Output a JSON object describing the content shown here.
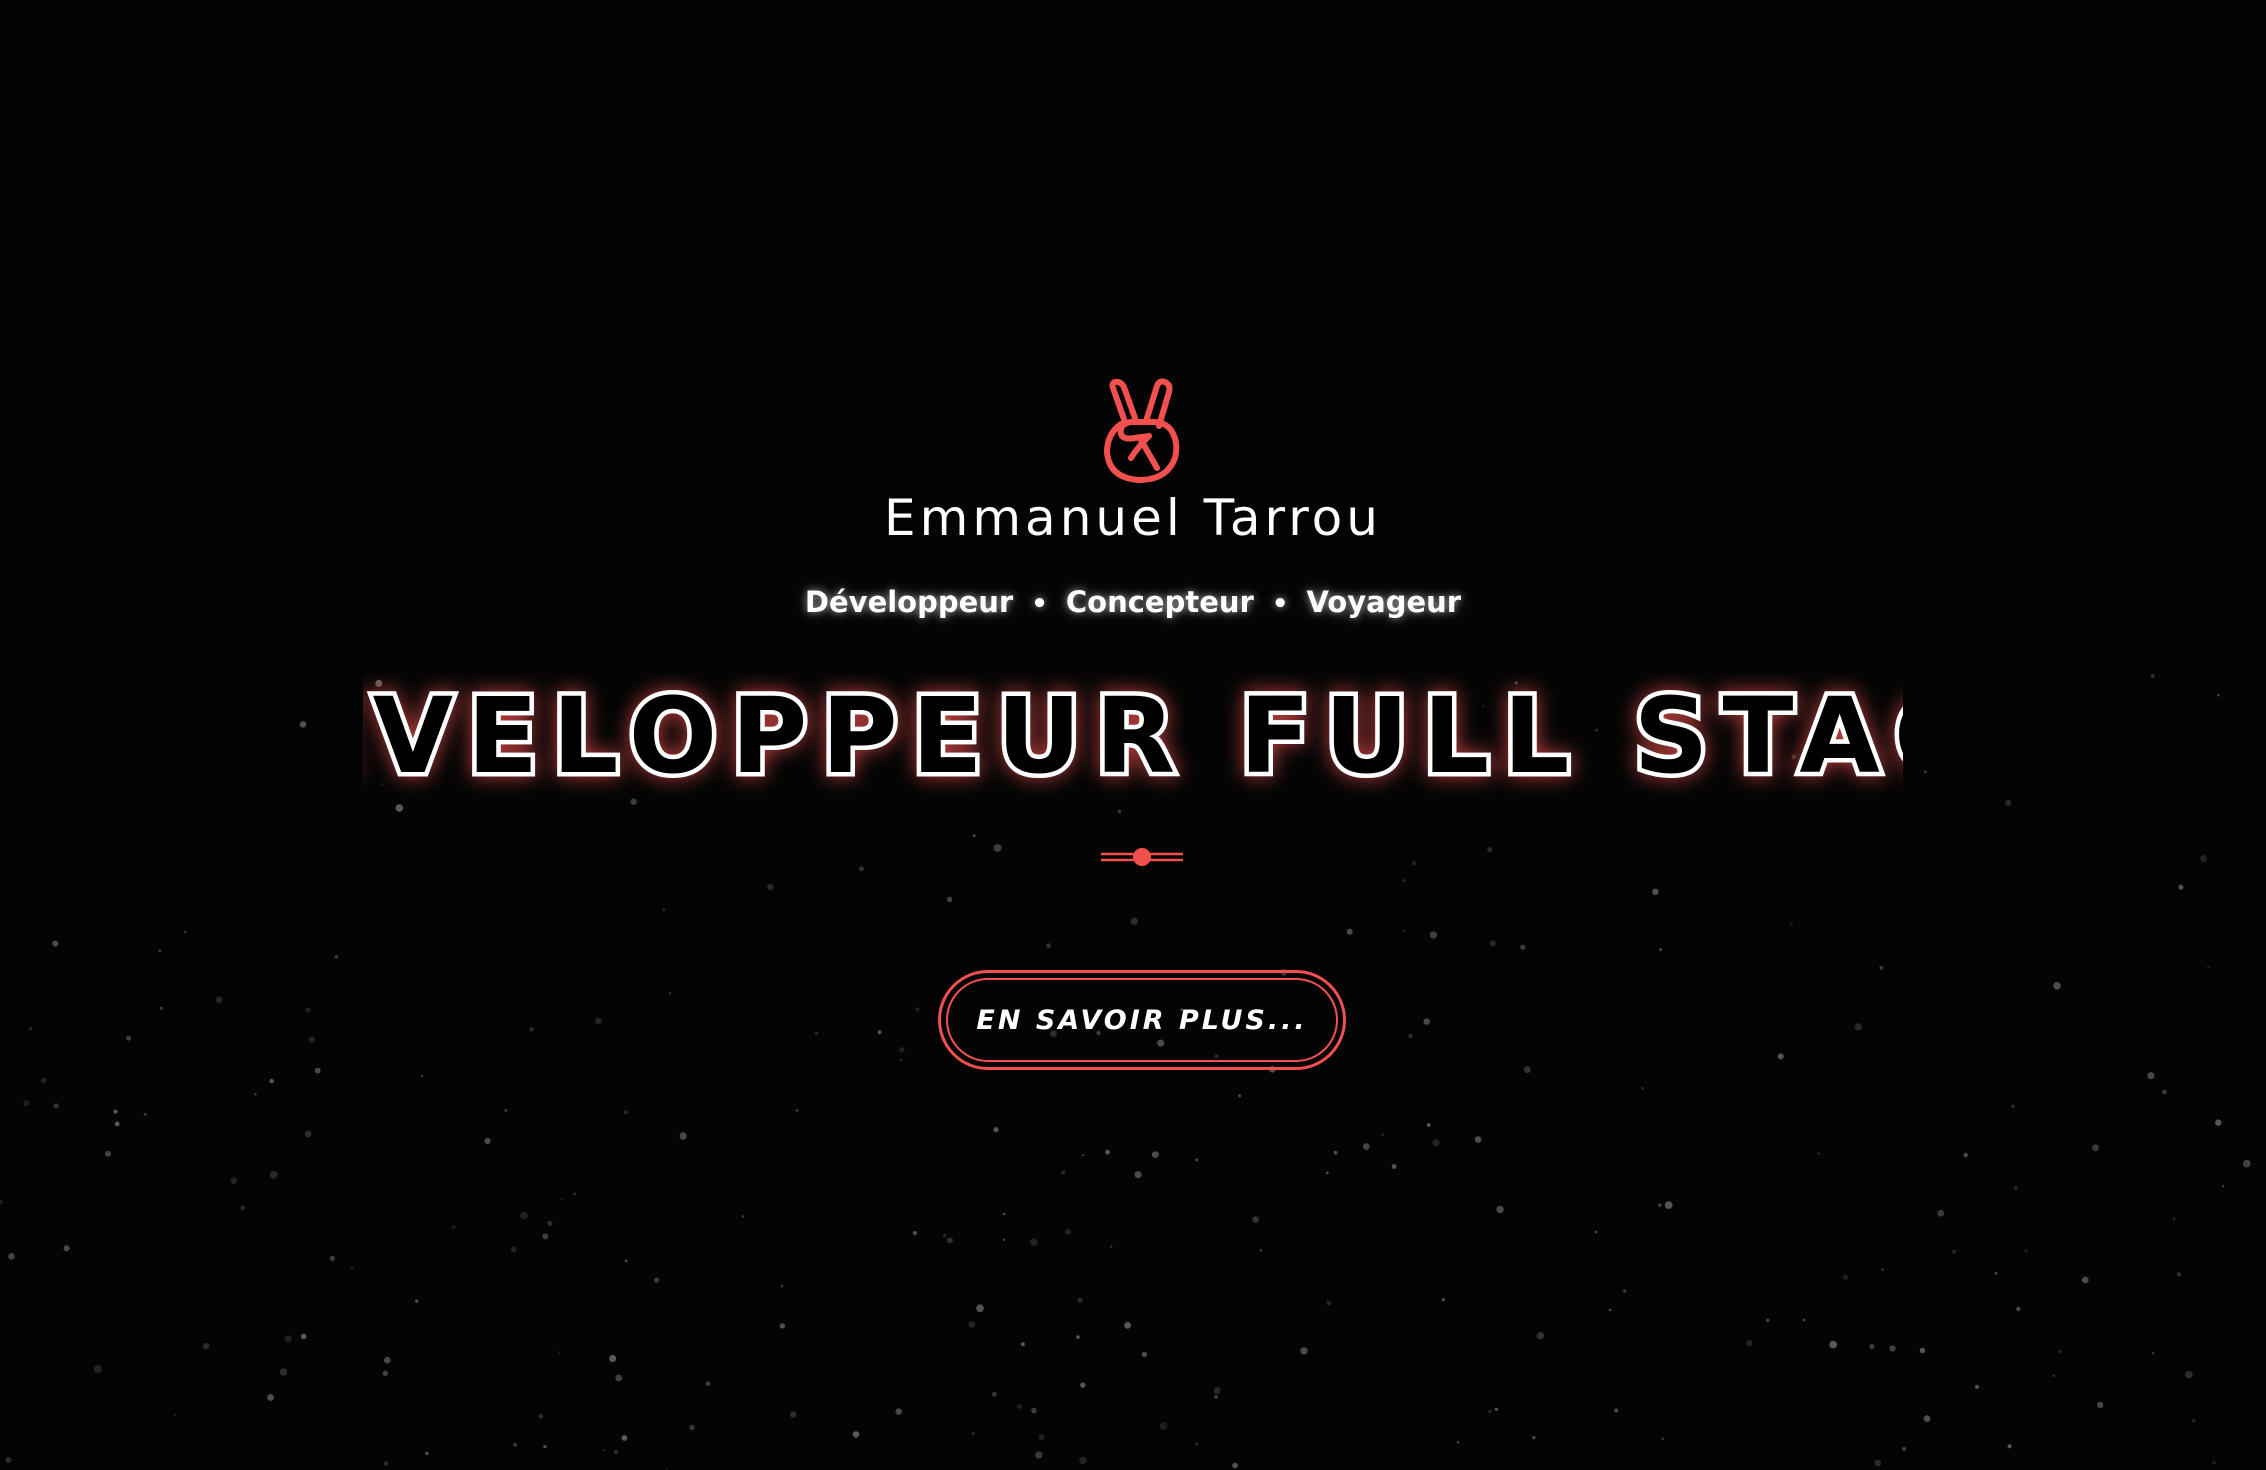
{
  "hero": {
    "logo_icon": "peace-hand-icon",
    "site_name": "Emmanuel Tarrou",
    "roles": [
      "Développeur",
      "Concepteur",
      "Voyageur"
    ],
    "role_separator": "•",
    "headline": "DÉVELOPPEUR FULL STACK",
    "divider_icon": "dot-line-divider-icon",
    "cta_label": "EN SAVOIR PLUS..."
  },
  "colors": {
    "accent": "#f2504f",
    "background": "#040404",
    "text": "#ffffff",
    "stars": "#6b6b6b"
  }
}
